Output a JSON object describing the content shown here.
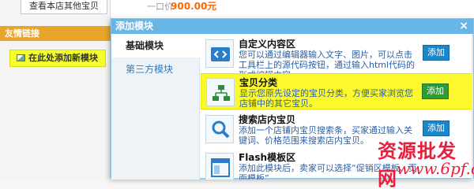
{
  "background": {
    "view_shop_items": "查看本店其他宝贝",
    "price_label": "一口价",
    "price_value": "900.00元",
    "friend_links": "友情链接",
    "add_new_module": "在此处添加新模块"
  },
  "modal": {
    "title": "添加模块",
    "close": "×",
    "tabs": [
      {
        "label": "基础模块"
      },
      {
        "label": "第三方模块"
      }
    ],
    "items": [
      {
        "icon": "code-icon",
        "title": "自定义内容区",
        "desc": "您可以通过编辑器输入文字、图片，可以点击工具栏上的源代码按钮，通过输入html代码的形式编辑内容。",
        "button": "添加"
      },
      {
        "icon": "category-tree-icon",
        "title": "宝贝分类",
        "desc": "显示您原先设定的宝贝分类，方便买家浏览您店铺中的其它宝贝。",
        "button": "添加"
      },
      {
        "icon": "search-icon",
        "title": "搜索店内宝贝",
        "desc": "添加一个店铺内宝贝搜索条，买家通过输入关键词、价格范围来搜索店内宝贝。",
        "button": "添加"
      },
      {
        "icon": "flash-template-icon",
        "title": "Flash模板区",
        "desc": "添加此模块后，卖家可以选择“促销区模板、页面模板”",
        "button": ""
      }
    ],
    "colors": {
      "header": "#67b6e6",
      "add_button": "#1a86cc",
      "highlight": "#fbf92e",
      "highlight_button": "#2f9a37"
    }
  },
  "watermark": {
    "line1": "资源批发网",
    "line2": "www.6pf.cn"
  }
}
